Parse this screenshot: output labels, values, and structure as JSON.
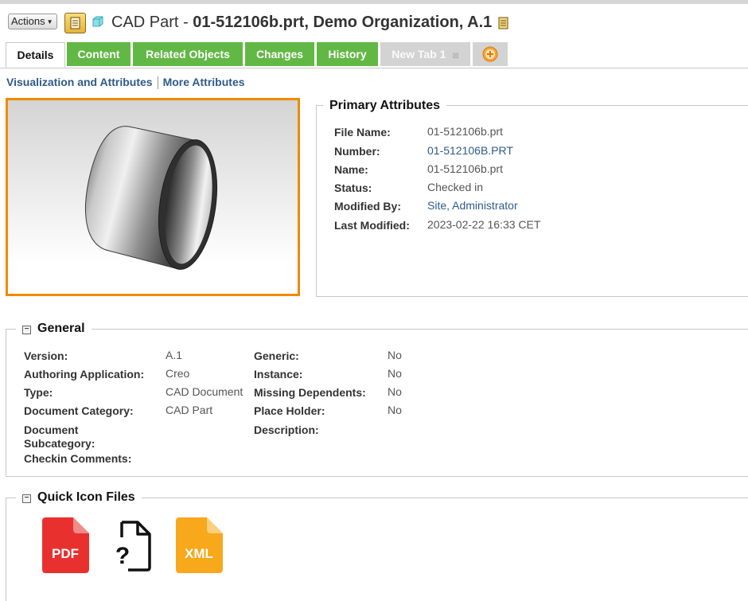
{
  "header": {
    "actions_label": "Actions",
    "title_prefix": "CAD Part - ",
    "title_main": "01-512106b.prt, Demo Organization, A.1"
  },
  "tabs": [
    {
      "label": "Details",
      "state": "active"
    },
    {
      "label": "Content",
      "state": "green"
    },
    {
      "label": "Related Objects",
      "state": "green"
    },
    {
      "label": "Changes",
      "state": "green"
    },
    {
      "label": "History",
      "state": "green"
    },
    {
      "label": "New Tab 1",
      "state": "gray"
    }
  ],
  "subnav": {
    "item1": "Visualization and Attributes",
    "item2": "More Attributes"
  },
  "primary": {
    "title": "Primary Attributes",
    "rows": [
      {
        "label": "File Name:",
        "value": "01-512106b.prt"
      },
      {
        "label": "Number:",
        "value": "01-512106B.PRT"
      },
      {
        "label": "Name:",
        "value": "01-512106b.prt"
      },
      {
        "label": "Status:",
        "value": "Checked in"
      },
      {
        "label": "Modified By:",
        "value": "Site, Administrator"
      },
      {
        "label": "Last Modified:",
        "value": "2023-02-22 16:33 CET"
      }
    ]
  },
  "general": {
    "title": "General",
    "left": [
      {
        "label": "Version:",
        "value": "A.1"
      },
      {
        "label": "Authoring Application:",
        "value": "Creo"
      },
      {
        "label": "Type:",
        "value": "CAD Document"
      },
      {
        "label": "Document Category:",
        "value": "CAD Part"
      },
      {
        "label": "Document Subcategory:",
        "value": ""
      },
      {
        "label": "Checkin Comments:",
        "value": ""
      }
    ],
    "right": [
      {
        "label": "Generic:",
        "value": "No"
      },
      {
        "label": "Instance:",
        "value": "No"
      },
      {
        "label": "Missing Dependents:",
        "value": "No"
      },
      {
        "label": "Place Holder:",
        "value": "No"
      },
      {
        "label": "Description:",
        "value": ""
      }
    ]
  },
  "quick": {
    "title": "Quick Icon Files",
    "files": [
      {
        "icon": "pdf-file-icon",
        "label": "PDF",
        "color": "#e8312f"
      },
      {
        "icon": "unknown-file-icon",
        "label": "?",
        "color": "#111111"
      },
      {
        "icon": "xml-file-icon",
        "label": "XML",
        "color": "#f7a81b"
      }
    ]
  },
  "colors": {
    "tab_green": "#62b845",
    "tab_gray": "#d3d3d3",
    "viewer_border": "#f08a00",
    "link": "#2e5b8a"
  }
}
